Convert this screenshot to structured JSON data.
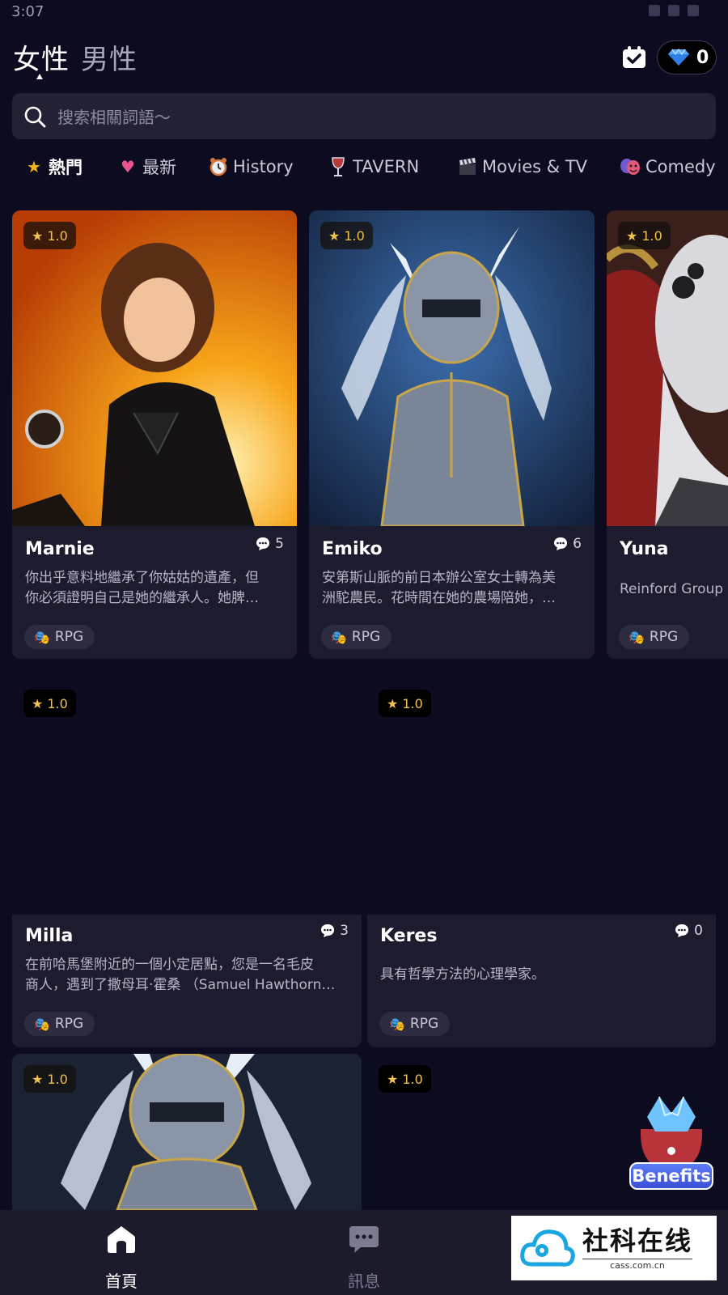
{
  "status_bar": {
    "time": "3:07"
  },
  "header": {
    "tab_female": "女性",
    "tab_male": "男性",
    "gem_count": "0"
  },
  "search": {
    "placeholder": "搜索相關詞語～"
  },
  "categories": [
    {
      "label": "熱門",
      "icon": "star-icon"
    },
    {
      "label": "最新",
      "icon": "heart-icon"
    },
    {
      "label": "History",
      "icon": "clock-icon"
    },
    {
      "label": "TAVERN",
      "icon": "wine-glass-icon"
    },
    {
      "label": "Movies & TV",
      "icon": "clapperboard-icon"
    },
    {
      "label": "Comedy",
      "icon": "theater-masks-icon"
    }
  ],
  "cards": [
    {
      "rating": "1.0",
      "name": "Marnie",
      "comments": "5",
      "desc_line1": "你出乎意料地繼承了你姑姑的遺產，但",
      "desc_line2": "你必須證明自己是她的繼承人。她脾…",
      "tag": "RPG"
    },
    {
      "rating": "1.0",
      "name": "Emiko",
      "comments": "6",
      "desc_line1": "安第斯山脈的前日本辦公室女士轉為美",
      "desc_line2": "洲駝農民。花時間在她的農場陪她，…",
      "tag": "RPG"
    },
    {
      "rating": "1.0",
      "name": "Yuna",
      "comments": "",
      "desc_line1": "Reinford Group",
      "desc_line2": "",
      "tag": "RPG"
    },
    {
      "rating": "1.0",
      "name": "Milla",
      "comments": "3",
      "desc_line1": "在前哈馬堡附近的一個小定居點，您是一名毛皮",
      "desc_line2": "商人，遇到了撒母耳·霍桑 （Samuel Hawthorn…",
      "tag": "RPG"
    },
    {
      "rating": "1.0",
      "name": "Keres",
      "comments": "0",
      "desc_line1": "具有哲學方法的心理學家。",
      "desc_line2": "",
      "tag": "RPG"
    },
    {
      "rating": "1.0"
    },
    {
      "rating": "1.0"
    }
  ],
  "floating": {
    "label": "Benefits"
  },
  "bottom_nav": {
    "home": "首頁",
    "messages": "訊息"
  },
  "watermark": {
    "title": "社科在线",
    "subtitle": "cass.com.cn"
  }
}
